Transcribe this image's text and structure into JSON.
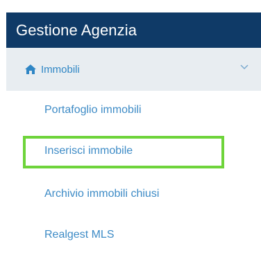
{
  "header": {
    "title": "Gestione Agenzia"
  },
  "section": {
    "label": "Immobili",
    "icon": "home-icon",
    "expand_icon": "chevron-down-icon"
  },
  "items": [
    {
      "label": "Portafoglio immobili"
    },
    {
      "label": "Inserisci immobile",
      "highlighted": true
    },
    {
      "label": "Archivio immobili chiusi"
    },
    {
      "label": "Realgest MLS"
    }
  ],
  "colors": {
    "header_bg": "#0f3a67",
    "section_bg": "#e8edf1",
    "link": "#3d8bc6",
    "highlight": "#6ed43a"
  }
}
